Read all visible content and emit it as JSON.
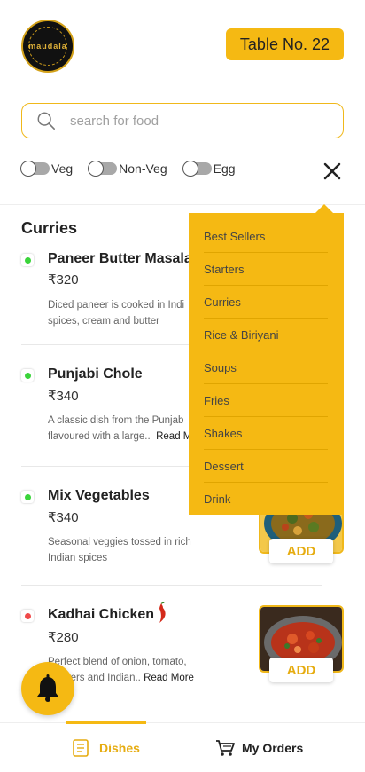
{
  "header": {
    "logo_text": "maudala",
    "table_label": "Table No. 22"
  },
  "search": {
    "placeholder": "search for food",
    "value": ""
  },
  "filters": [
    {
      "label": "Veg",
      "on": false
    },
    {
      "label": "Non-Veg",
      "on": false
    },
    {
      "label": "Egg",
      "on": false
    }
  ],
  "section": {
    "title": "Curries"
  },
  "items": [
    {
      "name": "Paneer Butter Masala",
      "price": "₹320",
      "desc_line1": "Diced paneer is cooked in Indi",
      "desc_line2": "spices, cream and butter",
      "read_more": "",
      "type": "veg",
      "has_add": false
    },
    {
      "name": "Punjabi Chole",
      "price": "₹340",
      "desc_line1": "A classic dish from the Punjab",
      "desc_line2": "flavoured with a large..",
      "read_more": "Read M",
      "type": "veg",
      "has_add": false
    },
    {
      "name": "Mix Vegetables",
      "price": "₹340",
      "desc_line1": "Seasonal veggies tossed in rich",
      "desc_line2": "Indian spices",
      "read_more": "",
      "type": "veg",
      "has_add": true,
      "add_label": "ADD"
    },
    {
      "name": "Kadhai Chicken",
      "price": "₹280",
      "desc_line1": "Perfect blend of onion, tomato,",
      "desc_line2": "peppers and Indian..",
      "read_more": "Read More",
      "type": "non-veg",
      "has_add": true,
      "add_label": "ADD"
    }
  ],
  "menu": {
    "items": [
      "Best Sellers",
      "Starters",
      "Curries",
      "Rice & Biriyani",
      "Soups",
      "Fries",
      "Shakes",
      "Dessert",
      "Drink"
    ]
  },
  "bottom_nav": {
    "dishes_label": "Dishes",
    "orders_label": "My Orders"
  },
  "colors": {
    "accent": "#f5b913",
    "veg": "#3ad43a",
    "non_veg": "#f04a4a"
  },
  "icons": [
    "search-icon",
    "close-icon",
    "bell-icon",
    "menu-book-icon",
    "cart-icon",
    "chili-icon"
  ]
}
